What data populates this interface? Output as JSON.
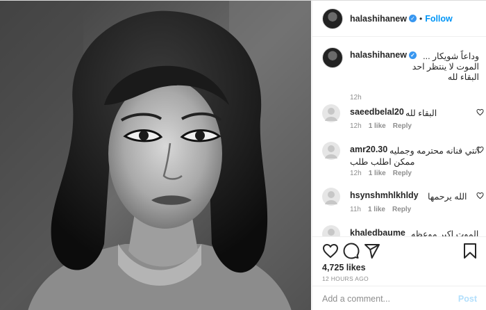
{
  "post": {
    "username": "halashihanew",
    "follow_label": "Follow",
    "dot": "•",
    "verified_mark": "✓",
    "photo_desc_icon": "photo-bw-portrait",
    "accent": "#0095f6"
  },
  "caption": {
    "username": "halashihanew",
    "lines": [
      "وداعاً شويكار ...",
      "الموت لا ينتظر احد",
      "البقاء لله"
    ],
    "time": "12h"
  },
  "comments": [
    {
      "username": "saeedbelal20",
      "text": "البقاء لله",
      "text2": "",
      "time": "12h",
      "likes": "1 like",
      "reply": "Reply"
    },
    {
      "username": "amr20.30",
      "text": "انتي فنانه محترمه وجمليه",
      "text2": "ممكن اطلب طلب",
      "time": "12h",
      "likes": "1 like",
      "reply": "Reply"
    },
    {
      "username": "hsynshmhlkhldy",
      "text": "الله يرحمها",
      "text2": "",
      "time": "11h",
      "likes": "1 like",
      "reply": "Reply"
    },
    {
      "username": "khaledbaume",
      "text": "الموت اكبر موعظه",
      "text2": "",
      "time": "",
      "likes": "",
      "reply": ""
    }
  ],
  "stats": {
    "likes": "4,725 likes",
    "ago": "12 HOURS AGO"
  },
  "composer": {
    "placeholder": "Add a comment...",
    "post_label": "Post"
  },
  "icons": [
    "heart-icon",
    "comment-icon",
    "share-icon",
    "bookmark-icon"
  ]
}
